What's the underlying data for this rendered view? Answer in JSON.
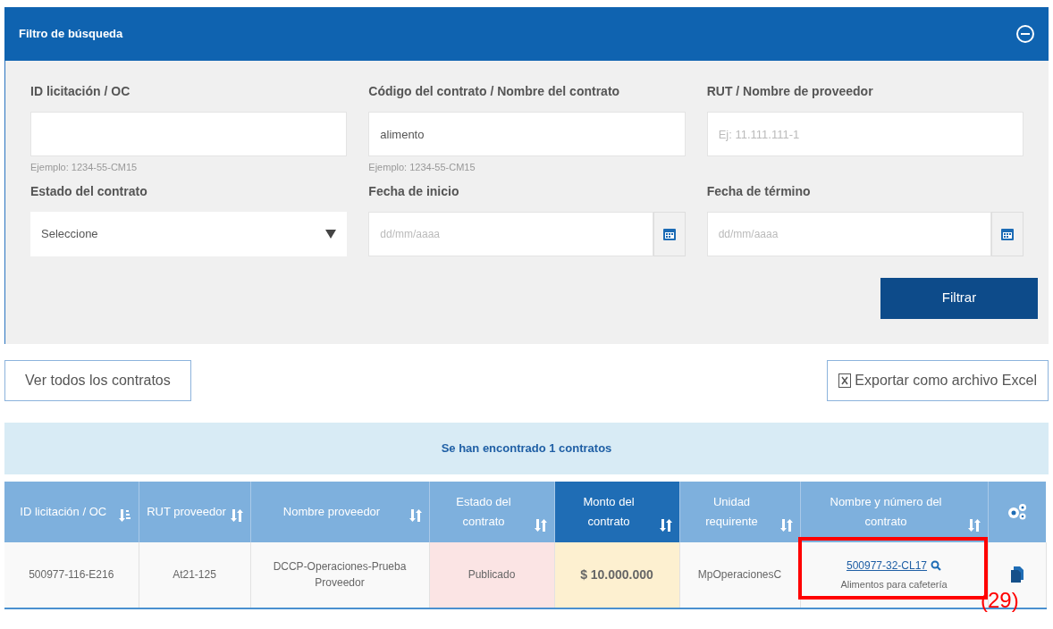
{
  "filter_panel": {
    "title": "Filtro de búsqueda",
    "expanded": true,
    "fields": [
      {
        "kind": "text",
        "label": "ID licitación / OC",
        "hint": "Ejemplo: 1234-55-CM15"
      },
      {
        "kind": "text",
        "label": "Código del contrato / Nombre del contrato",
        "value": "alimento",
        "hint": "Ejemplo: 1234-55-CM15"
      },
      {
        "kind": "text",
        "label": "RUT / Nombre de proveedor",
        "placeholder": "Ej: 11.111.111-1"
      },
      {
        "kind": "select",
        "label": "Estado del contrato",
        "value": "Seleccione"
      },
      {
        "kind": "date",
        "label": "Fecha de inicio",
        "placeholder": "dd/mm/aaaa"
      },
      {
        "kind": "date",
        "label": "Fecha de término",
        "placeholder": "dd/mm/aaaa"
      }
    ],
    "submit": "Filtrar"
  },
  "actions": {
    "view_all": "Ver todos los contratos",
    "export": "Exportar como archivo Excel"
  },
  "results_message": "Se han encontrado 1 contratos",
  "table": {
    "columns": [
      {
        "kind": "sorted",
        "label": "ID licitación / OC",
        "selected": false
      },
      {
        "kind": "sortable",
        "label": "RUT proveedor",
        "selected": false
      },
      {
        "kind": "sortable",
        "label": "Nombre proveedor",
        "selected": false
      },
      {
        "kind": "sortable",
        "label": "Estado del contrato",
        "selected": false
      },
      {
        "kind": "sortable",
        "label": "Monto del contrato",
        "selected": true
      },
      {
        "kind": "sortable",
        "label": "Unidad requirente",
        "selected": false
      },
      {
        "kind": "sortable",
        "label": "Nombre y número del contrato",
        "selected": false
      },
      {
        "kind": "settings",
        "selected": false
      }
    ],
    "rows": [
      {
        "cells": [
          {
            "kind": "text",
            "text": "500977-116-E216"
          },
          {
            "kind": "text",
            "text": "At21-125"
          },
          {
            "kind": "text",
            "text": "DCCP-Operaciones-Prueba Proveedor"
          },
          {
            "kind": "status",
            "text": "Publicado"
          },
          {
            "kind": "amount",
            "text": "$ 10.000.000"
          },
          {
            "kind": "text",
            "text": "MpOperacionesC"
          },
          {
            "kind": "link",
            "text": "500977-32-CL17",
            "subtext": "Alimentos para cafetería"
          },
          {
            "kind": "document"
          }
        ]
      }
    ]
  },
  "annotation": {
    "label": "(29)"
  }
}
